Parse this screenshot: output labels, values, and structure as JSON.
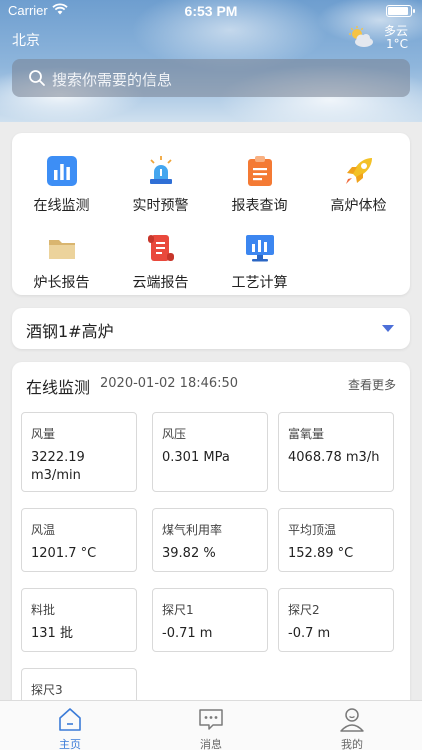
{
  "status_bar": {
    "carrier": "Carrier",
    "time": "6:53 PM",
    "icons": [
      "wifi-icon",
      "battery-icon"
    ]
  },
  "header": {
    "city": "北京",
    "weather": {
      "icon": "partly-cloudy-icon",
      "description": "多云",
      "temperature": "1°C"
    },
    "search": {
      "placeholder": "搜索你需要的信息",
      "icon": "search-icon"
    }
  },
  "menu": {
    "items": [
      {
        "label": "在线监测",
        "icon": "bar-chart-icon",
        "color": "#3d8ef5"
      },
      {
        "label": "实时预警",
        "icon": "alarm-light-icon",
        "color": "#45a6ef"
      },
      {
        "label": "报表查询",
        "icon": "clipboard-icon",
        "color": "#f47a34"
      },
      {
        "label": "高炉体检",
        "icon": "rocket-icon",
        "color": "#f3c126"
      },
      {
        "label": "炉长报告",
        "icon": "folder-icon",
        "color": "#e9c98a"
      },
      {
        "label": "云端报告",
        "icon": "scroll-icon",
        "color": "#e9493c"
      },
      {
        "label": "工艺计算",
        "icon": "monitor-chart-icon",
        "color": "#3c86f0"
      }
    ]
  },
  "furnace_selector": {
    "selected": "酒钢1#高炉",
    "icon": "caret-down-icon"
  },
  "monitor": {
    "title": "在线监测",
    "timestamp": "2020-01-02 18:46:50",
    "more_label": "查看更多",
    "metrics": [
      {
        "label": "风量",
        "value": "3222.19 m3/min"
      },
      {
        "label": "风压",
        "value": "0.301 MPa"
      },
      {
        "label": "富氧量",
        "value": "4068.78 m3/h"
      },
      {
        "label": "风温",
        "value": "1201.7 °C"
      },
      {
        "label": "煤气利用率",
        "value": "39.82 %"
      },
      {
        "label": "平均顶温",
        "value": "152.89 °C"
      },
      {
        "label": "料批",
        "value": "131 批"
      },
      {
        "label": "探尺1",
        "value": "-0.71 m"
      },
      {
        "label": "探尺2",
        "value": "-0.7 m"
      },
      {
        "label": "探尺3",
        "value": ""
      }
    ]
  },
  "tabbar": {
    "active_color": "#3b7bd8",
    "tabs": [
      {
        "label": "主页",
        "icon": "home-icon",
        "active": true
      },
      {
        "label": "消息",
        "icon": "message-icon",
        "active": false
      },
      {
        "label": "我的",
        "icon": "user-icon",
        "active": false
      }
    ]
  }
}
